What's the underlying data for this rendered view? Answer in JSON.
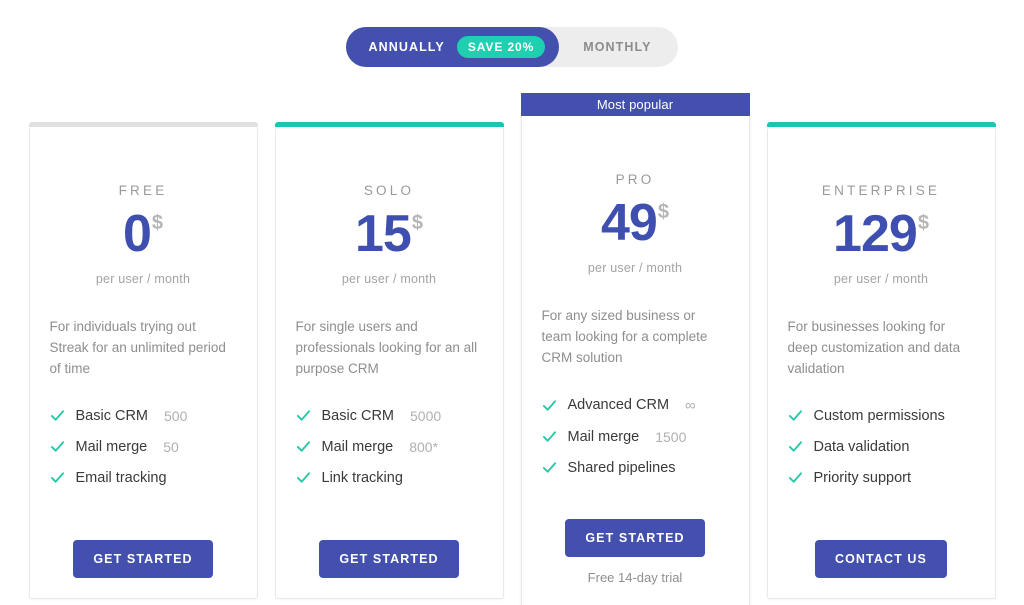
{
  "billing_toggle": {
    "annually_label": "ANNUALLY",
    "save_badge": "SAVE 20%",
    "monthly_label": "MONTHLY",
    "active": "annually",
    "active_bg": "#4350ae",
    "badge_bg": "#1ecfb0",
    "track_bg": "#ededed"
  },
  "plans": [
    {
      "name": "FREE",
      "accent_color": "#e0e0e0",
      "price": "0",
      "currency": "$",
      "period": "per user / month",
      "description": "For individuals trying out Streak for an unlimited period of time",
      "features": [
        {
          "label": "Basic CRM",
          "qty": "500"
        },
        {
          "label": "Mail merge",
          "qty": "50"
        },
        {
          "label": "Email tracking",
          "qty": ""
        }
      ],
      "cta_label": "GET STARTED",
      "trial_note": "",
      "badge": ""
    },
    {
      "name": "SOLO",
      "accent_color": "#1bc5b4",
      "price": "15",
      "currency": "$",
      "period": "per user / month",
      "description": "For single users and professionals looking for an all purpose CRM",
      "features": [
        {
          "label": "Basic CRM",
          "qty": "5000"
        },
        {
          "label": "Mail merge",
          "qty": "800*"
        },
        {
          "label": "Link tracking",
          "qty": ""
        }
      ],
      "cta_label": "GET STARTED",
      "trial_note": "",
      "badge": ""
    },
    {
      "name": "PRO",
      "accent_color": "#4350ae",
      "price": "49",
      "currency": "$",
      "period": "per user / month",
      "description": "For any sized business or team looking for a complete CRM solution",
      "features": [
        {
          "label": "Advanced CRM",
          "qty": "∞"
        },
        {
          "label": "Mail merge",
          "qty": "1500"
        },
        {
          "label": "Shared pipelines",
          "qty": ""
        }
      ],
      "cta_label": "GET STARTED",
      "trial_note": "Free 14-day trial",
      "badge": "Most popular"
    },
    {
      "name": "ENTERPRISE",
      "accent_color": "#1bc5b4",
      "price": "129",
      "currency": "$",
      "period": "per user / month",
      "description": "For businesses looking for deep customization and data validation",
      "features": [
        {
          "label": "Custom permissions",
          "qty": ""
        },
        {
          "label": "Data validation",
          "qty": ""
        },
        {
          "label": "Priority support",
          "qty": ""
        }
      ],
      "cta_label": "CONTACT US",
      "trial_note": "",
      "badge": ""
    }
  ],
  "colors": {
    "check_green": "#25c9a8",
    "price_blue": "#3f4fb0",
    "muted_text": "#8e8e8e"
  }
}
